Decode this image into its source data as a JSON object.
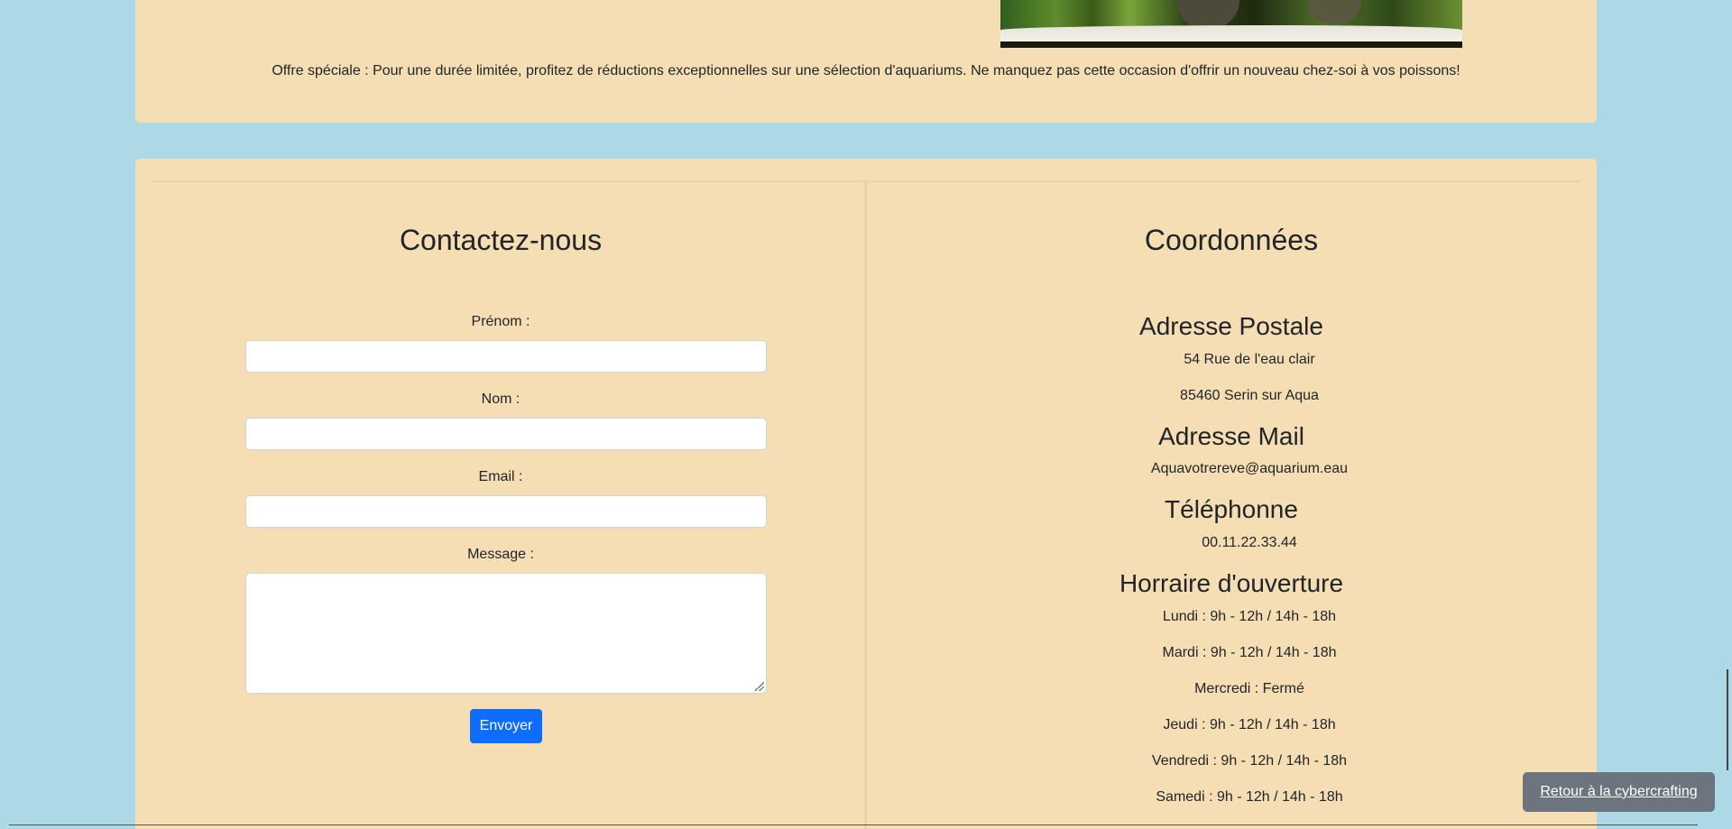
{
  "promo": {
    "text": "Offre spéciale : Pour une durée limitée, profitez de réductions exceptionnelles sur une sélection d'aquariums. Ne manquez pas cette occasion d'offrir un nouveau chez-soi à vos poissons!"
  },
  "contact_form": {
    "title": "Contactez-nous",
    "firstname_label": "Prénom :",
    "firstname_value": "",
    "lastname_label": "Nom :",
    "lastname_value": "",
    "email_label": "Email :",
    "email_value": "",
    "message_label": "Message :",
    "message_value": "",
    "submit_label": "Envoyer"
  },
  "coordinates": {
    "title": "Coordonnées",
    "postal": {
      "heading": "Adresse Postale",
      "lines": [
        "54 Rue de l'eau clair",
        "85460 Serin sur Aqua"
      ]
    },
    "mail": {
      "heading": "Adresse Mail",
      "value": "Aquavotrereve@aquarium.eau"
    },
    "phone": {
      "heading": "Téléphonne",
      "value": "00.11.22.33.44"
    },
    "hours": {
      "heading": "Horraire d'ouverture",
      "days": [
        "Lundi : 9h - 12h / 14h - 18h",
        "Mardi : 9h - 12h / 14h - 18h",
        "Mercredi : Fermé",
        "Jeudi : 9h - 12h / 14h - 18h",
        "Vendredi : 9h - 12h / 14h - 18h",
        "Samedi : 9h - 12h / 14h - 18h"
      ]
    }
  },
  "back_link": {
    "label": "Retour à la cybercrafting"
  },
  "colors": {
    "page_background": "#add8e6",
    "card_background": "#f5deb3",
    "primary_button": "#0d6efd",
    "back_button": "#6c757d"
  }
}
